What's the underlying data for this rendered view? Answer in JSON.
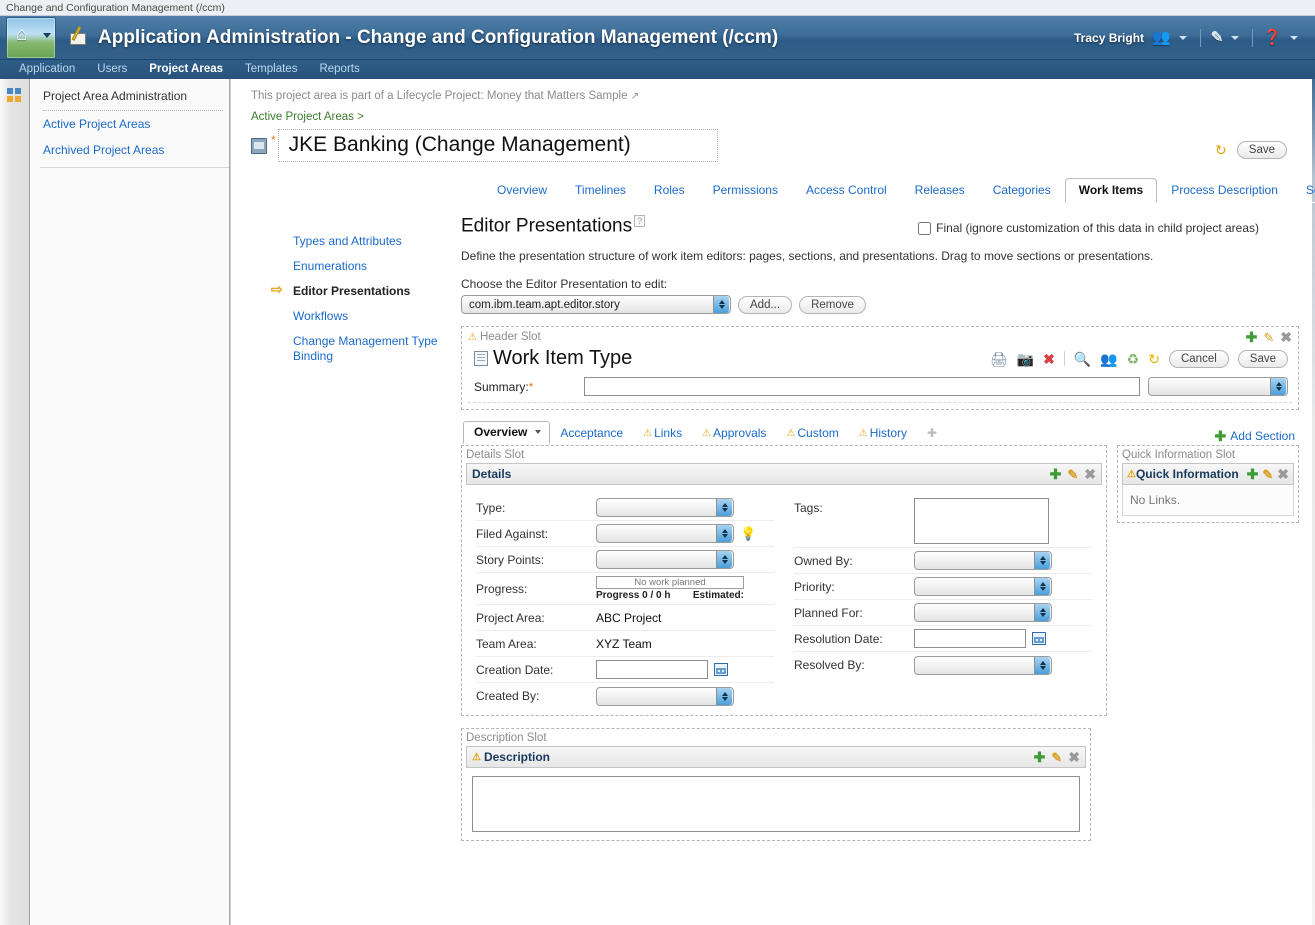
{
  "browser": {
    "page_title": "Change and Configuration Management (/ccm)"
  },
  "banner": {
    "title": "Application Administration - Change and Configuration Management (/ccm)",
    "home_icon": "home-icon",
    "app_icon": "admin-app-icon",
    "user_name": "Tracy Bright",
    "user_icon": "users-group-icon",
    "admin_icon": "admin-pencil-icon",
    "help_icon": "help-question-icon",
    "caret": "▾"
  },
  "nav": {
    "items": [
      {
        "label": "Application",
        "active": false
      },
      {
        "label": "Users",
        "active": false
      },
      {
        "label": "Project Areas",
        "active": true
      },
      {
        "label": "Templates",
        "active": false
      },
      {
        "label": "Reports",
        "active": false
      }
    ]
  },
  "sidebar": {
    "rail_icon": "squares-grid-icon",
    "title": "Project Area Administration",
    "items": [
      {
        "label": "Active Project Areas"
      },
      {
        "label": "Archived Project Areas"
      }
    ]
  },
  "page": {
    "lifecycle_note": "This project area is part of a Lifecycle Project:",
    "lifecycle_project": "Money that Matters Sample",
    "external_link_icon": "↗",
    "breadcrumb": "Active Project Areas >",
    "project_icon": "project-area-icon",
    "dirty_marker": "*",
    "project_title": "JKE Banking (Change Management)",
    "revert_icon": "revert-icon",
    "save_label": "Save"
  },
  "tabs": [
    {
      "label": "Overview",
      "active": false
    },
    {
      "label": "Timelines",
      "active": false
    },
    {
      "label": "Roles",
      "active": false
    },
    {
      "label": "Permissions",
      "active": false
    },
    {
      "label": "Access Control",
      "active": false
    },
    {
      "label": "Releases",
      "active": false
    },
    {
      "label": "Categories",
      "active": false
    },
    {
      "label": "Work Items",
      "active": true
    },
    {
      "label": "Process Description",
      "active": false
    },
    {
      "label": "Social Network",
      "active": false
    }
  ],
  "subnav": [
    {
      "label": "Types and Attributes",
      "active": false
    },
    {
      "label": "Enumerations",
      "active": false
    },
    {
      "label": "Editor Presentations",
      "active": true
    },
    {
      "label": "Workflows",
      "active": false
    },
    {
      "label": "Change Management Type Binding",
      "active": false
    }
  ],
  "editor": {
    "heading": "Editor Presentations",
    "help_badge": "?",
    "final_label": "Final (ignore customization of this data in child project areas)",
    "final_checked": false,
    "description": "Define the presentation structure of work item editors: pages, sections, and presentations. Drag to move sections or presentations.",
    "choose_label": "Choose the Editor Presentation to edit:",
    "selected_presentation": "com.ibm.team.apt.editor.story",
    "add_label": "Add...",
    "remove_label": "Remove"
  },
  "preview": {
    "header_slot_label": "Header Slot",
    "warn_icon": "warning-icon",
    "work_item_type_title": "Work Item Type",
    "work_item_icon": "work-item-icon",
    "toolbar_icons": [
      {
        "name": "print-icon",
        "glyph": "⎙",
        "color": "#6f87a0"
      },
      {
        "name": "screenshot-icon",
        "glyph": "▣",
        "color": "#6f87a0"
      },
      {
        "name": "delete-icon",
        "glyph": "✖",
        "color": "#d94040"
      },
      {
        "name": "search-work-item-icon",
        "glyph": "⌕",
        "color": "#8fa3b6"
      },
      {
        "name": "subscribe-users-icon",
        "glyph": "♟",
        "color": "#8fa3b6"
      },
      {
        "name": "process-icon",
        "glyph": "♻",
        "color": "#7fae6d"
      },
      {
        "name": "revert-icon",
        "glyph": "↻",
        "color": "#e8b400"
      }
    ],
    "cancel_label": "Cancel",
    "save_label": "Save",
    "summary_label": "Summary:",
    "summary_required": "*",
    "summary_value": "",
    "status_value": "",
    "section_tabs": [
      {
        "label": "Overview",
        "active": true,
        "warn": false
      },
      {
        "label": "Acceptance",
        "active": false,
        "warn": false
      },
      {
        "label": "Links",
        "active": false,
        "warn": true
      },
      {
        "label": "Approvals",
        "active": false,
        "warn": true
      },
      {
        "label": "Custom",
        "active": false,
        "warn": true
      },
      {
        "label": "History",
        "active": false,
        "warn": true
      }
    ],
    "add_tab_icon": "add-tab-icon",
    "add_section_label": "Add Section",
    "details_slot_label": "Details Slot",
    "details_section_label": "Details",
    "quick_info_slot_label": "Quick Information Slot",
    "quick_info_section_label": "Quick Information",
    "quick_info_body": "No Links.",
    "description_slot_label": "Description Slot",
    "description_section_label": "Description",
    "fields_left": [
      {
        "label": "Type:",
        "control": "select",
        "value": ""
      },
      {
        "label": "Filed Against:",
        "control": "select-bulb",
        "value": ""
      },
      {
        "label": "Story Points:",
        "control": "select",
        "value": ""
      },
      {
        "label": "Progress:",
        "control": "progress",
        "bar_text": "No work planned",
        "progress_text": "Progress 0 / 0 h",
        "estimated_text": "Estimated:"
      },
      {
        "label": "Project Area:",
        "control": "text-value",
        "value": "ABC Project"
      },
      {
        "label": "Team Area:",
        "control": "text-value",
        "value": "XYZ Team"
      },
      {
        "label": "Creation Date:",
        "control": "date",
        "value": ""
      },
      {
        "label": "Created By:",
        "control": "select",
        "value": ""
      }
    ],
    "fields_right": [
      {
        "label": "Tags:",
        "control": "textarea",
        "value": ""
      },
      {
        "label": "Owned By:",
        "control": "select",
        "value": ""
      },
      {
        "label": "Priority:",
        "control": "select",
        "value": ""
      },
      {
        "label": "Planned For:",
        "control": "select",
        "value": ""
      },
      {
        "label": "Resolution Date:",
        "control": "date",
        "value": ""
      },
      {
        "label": "Resolved By:",
        "control": "select",
        "value": ""
      }
    ]
  },
  "colors": {
    "banner_blue": "#3c6c97",
    "link_blue": "#1b6ac9",
    "breadcrumb_green": "#3d7b2e",
    "accent_orange": "#e8a317",
    "plus_green": "#3f9b35"
  }
}
